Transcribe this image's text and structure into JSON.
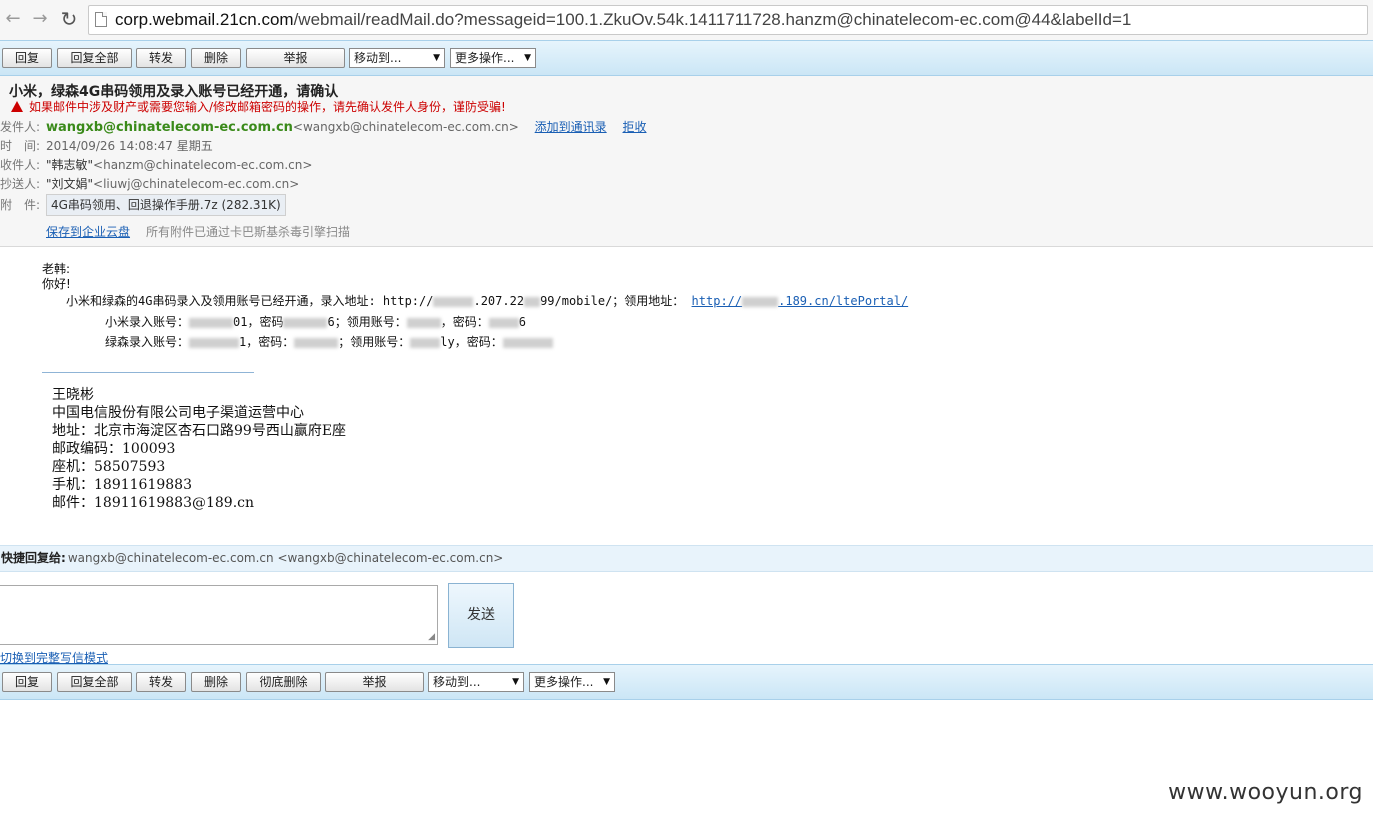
{
  "browser": {
    "url_host": "corp.webmail.21cn.com",
    "url_path": "/webmail/readMail.do?messageid=100.1.ZkuOv.54k.1411711728.hanzm@chinatelecom-ec.com@44&labelId=1"
  },
  "toolbar_top": {
    "reply": "回复",
    "reply_all": "回复全部",
    "forward": "转发",
    "delete": "删除",
    "report": "举报",
    "move_to": "移动到...",
    "more_actions": "更多操作..."
  },
  "mail": {
    "subject": "小米，绿森4G串码领用及录入账号已经开通，请确认",
    "warning": "如果邮件中涉及财产或需要您输入/修改邮箱密码的操作，请先确认发件人身份，谨防受骗!",
    "from_label": "发件人:",
    "from_name": "wangxb@chinatelecom-ec.com.cn",
    "from_addr": "<wangxb@chinatelecom-ec.com.cn>",
    "add_contact": "添加到通讯录",
    "reject": "拒收",
    "time_label": "时　间:",
    "time": "2014/09/26 14:08:47 星期五",
    "to_label": "收件人:",
    "to_name": "\"韩志敏\"",
    "to_addr": "<hanzm@chinatelecom-ec.com.cn>",
    "cc_label": "抄送人:",
    "cc_name": "\"刘文娟\"",
    "cc_addr": "<liuwj@chinatelecom-ec.com.cn>",
    "attach_label": "附　件:",
    "attachment": "4G串码领用、回退操作手册.7z (282.31K)",
    "save_cloud": "保存到企业云盘",
    "scan_note": "所有附件已通过卡巴斯基杀毒引擎扫描"
  },
  "body": {
    "greeting": "老韩:",
    "hello": "你好!",
    "line1_pre": "小米和绿森的4G串码录入及领用账号已经开通，录入地址: http://",
    "line1_mid": ".207.22",
    "line1_post": "99/mobile/；领用地址：",
    "line1_link_pre": "http://",
    "line1_link_post": ".189.cn/ltePortal/",
    "line2_pre": "小米录入账号：",
    "line2_a": "01，密码",
    "line2_b": "6；领用账号：",
    "line2_c": "，密码：",
    "line2_d": "6",
    "line3_pre": "绿森录入账号：",
    "line3_a": "1，密码：",
    "line3_b": "；领用账号：",
    "line3_c": "ly，密码：",
    "signature": [
      "王晓彬",
      "中国电信股份有限公司电子渠道运营中心",
      "地址：北京市海淀区杏石口路99号西山赢府E座",
      "邮政编码：100093",
      "座机：58507593",
      "手机：18911619883",
      "邮件：18911619883@189.cn"
    ]
  },
  "quick_reply": {
    "label": "快捷回复给:",
    "address": "wangxb@chinatelecom-ec.com.cn <wangxb@chinatelecom-ec.com.cn>",
    "send": "发送",
    "full_mode": "切换到完整写信模式"
  },
  "toolbar_bottom": {
    "reply": "回复",
    "reply_all": "回复全部",
    "forward": "转发",
    "delete": "删除",
    "purge": "彻底删除",
    "report": "举报",
    "move_to": "移动到...",
    "more_actions": "更多操作..."
  },
  "watermark": "www.wooyun.org"
}
